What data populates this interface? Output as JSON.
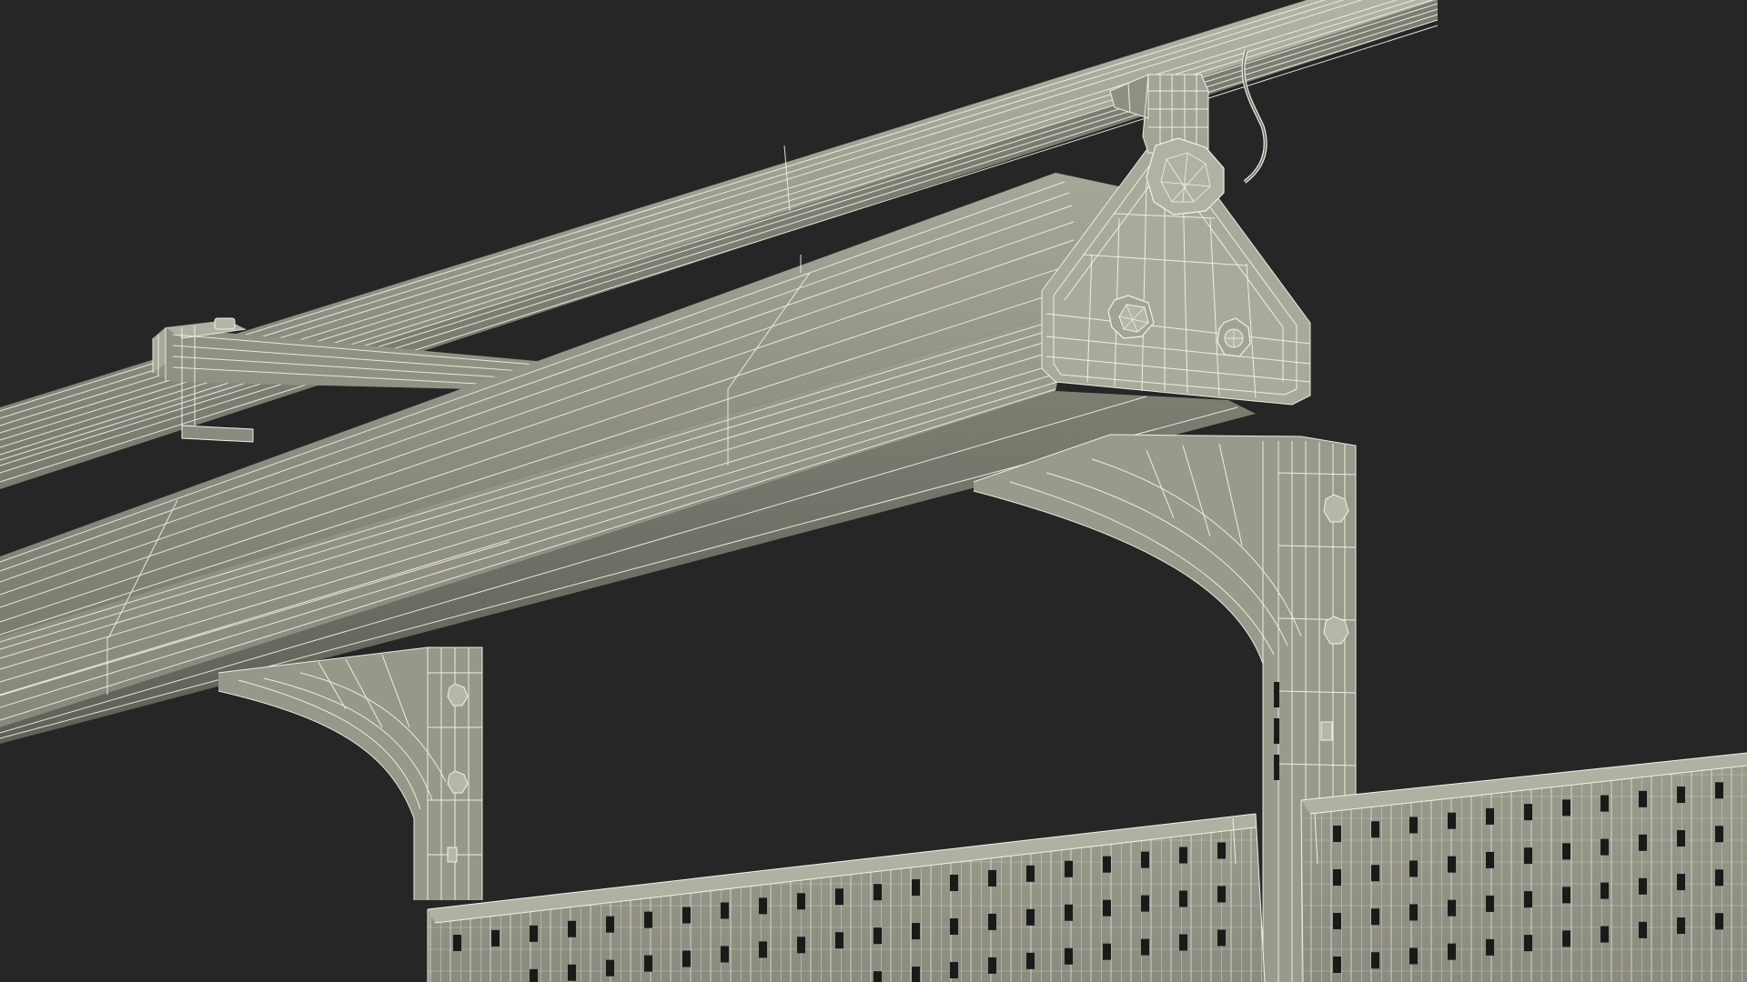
{
  "scene": {
    "subject": "wireframe-render-workbench-overhead-rail-lamp",
    "colors": {
      "background": "#262626",
      "metal_light": "#a4a596",
      "metal_mid": "#8e8f81",
      "metal_dark": "#6f7064",
      "metal_shadow": "#56574d",
      "wire": "#f2f2ea",
      "hole": "#1a1a1a"
    }
  }
}
